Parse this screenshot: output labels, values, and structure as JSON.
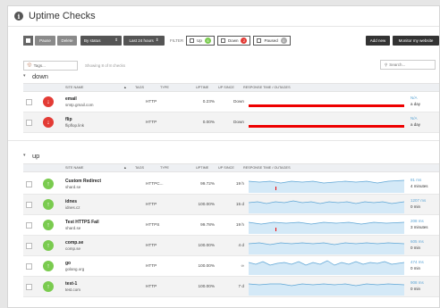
{
  "header": {
    "title": "Uptime Checks",
    "icon": "info-icon"
  },
  "toolbar": {
    "pause_label": "Pause",
    "delete_label": "Delete",
    "by_status_label": "By status",
    "time_label": "Last 24 hours",
    "filter_label": "FILTER",
    "filters": [
      {
        "label": "Up",
        "count": "6",
        "color": "#7acb4f"
      },
      {
        "label": "Down",
        "count": "2",
        "color": "#e33b35"
      },
      {
        "label": "Paused",
        "count": "0",
        "color": "#aaaaaa"
      }
    ],
    "add_new_label": "Add new",
    "monitor_label": "Monitor my website"
  },
  "search": {
    "tags_placeholder": "Tags...",
    "showing": "Showing 8 of 8 checks",
    "search_placeholder": "Search..."
  },
  "columns": {
    "site_name": "SITE NAME",
    "tags": "TAGS",
    "type": "TYPE",
    "uptime": "UPTIME",
    "up_since": "UP SINCE",
    "response": "RESPONSE TIME / OUTAGES"
  },
  "sections": [
    {
      "name": "down",
      "rows": [
        {
          "name": "email",
          "host": "smtp.gmail.com",
          "type": "HTTP",
          "uptime": "0.23%",
          "since": "Down",
          "rt": "N/A",
          "ago": "a day",
          "status": "down"
        },
        {
          "name": "flip",
          "host": "flipflop.link",
          "type": "HTTP",
          "uptime": "0.00%",
          "since": "Down",
          "rt": "N/A",
          "ago": "a day",
          "status": "down"
        }
      ]
    },
    {
      "name": "up",
      "rows": [
        {
          "name": "Custom Redirect",
          "host": "shard.se",
          "type": "HTTPC...",
          "uptime": "99.72%",
          "since": "19 h",
          "rt": "81 ms",
          "ago": "4 minutes",
          "status": "up"
        },
        {
          "name": "idnes",
          "host": "idnes.cz",
          "type": "HTTP",
          "uptime": "100.00%",
          "since": "15 d",
          "rt": "1207 ms",
          "ago": "0 min",
          "status": "up"
        },
        {
          "name": "Test HTTPS Fail",
          "host": "shard.se",
          "type": "HTTPS",
          "uptime": "99.78%",
          "since": "19 h",
          "rt": "208 ms",
          "ago": "3 minutes",
          "status": "up"
        },
        {
          "name": "comp.se",
          "host": "comp.se",
          "type": "HTTP",
          "uptime": "100.00%",
          "since": "4 d",
          "rt": "605 ms",
          "ago": "0 min",
          "status": "up"
        },
        {
          "name": "go",
          "host": "golang.org",
          "type": "HTTP",
          "uptime": "100.00%",
          "since": "∞",
          "rt": "474 ms",
          "ago": "0 min",
          "status": "up"
        },
        {
          "name": "test-1",
          "host": "test.com",
          "type": "HTTP",
          "uptime": "100.00%",
          "since": "7 d",
          "rt": "908 ms",
          "ago": "0 min",
          "status": "up"
        }
      ]
    }
  ],
  "colors": {
    "down": "#e33b35",
    "up": "#7acb4f",
    "spark_fill": "#d4e9f7",
    "spark_line": "#5da5d5",
    "outage": "#ee0000"
  }
}
